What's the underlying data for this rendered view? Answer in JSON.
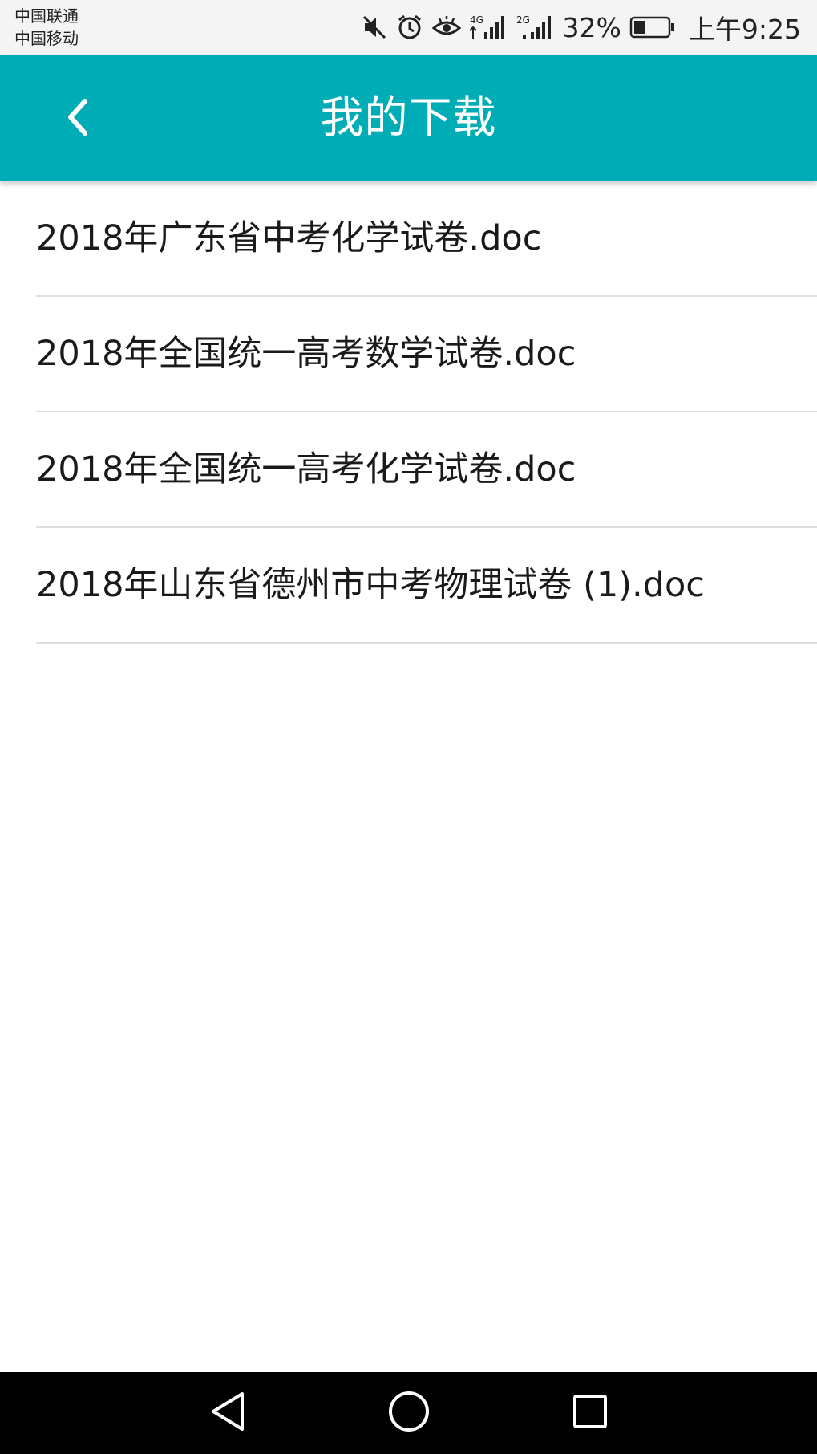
{
  "status_bar": {
    "carrier_1": "中国联通",
    "carrier_2": "中国移动",
    "icons": [
      "mute-icon",
      "alarm-icon",
      "eye-comfort-icon",
      "signal-4g-icon",
      "signal-2g-icon",
      "battery-icon"
    ],
    "signal_4g_label": "4G",
    "signal_2g_label": "2G",
    "battery_percent": "32%",
    "time": "上午9:25"
  },
  "app_bar": {
    "title": "我的下载",
    "back_icon": "chevron-left-icon",
    "color": "#00acb5"
  },
  "downloads": [
    {
      "name": "2018年广东省中考化学试卷.doc"
    },
    {
      "name": "2018年全国统一高考数学试卷.doc"
    },
    {
      "name": "2018年全国统一高考化学试卷.doc"
    },
    {
      "name": "2018年山东省德州市中考物理试卷 (1).doc"
    }
  ],
  "nav_bar": {
    "icons": [
      "back-triangle-icon",
      "home-circle-icon",
      "recents-square-icon"
    ]
  }
}
